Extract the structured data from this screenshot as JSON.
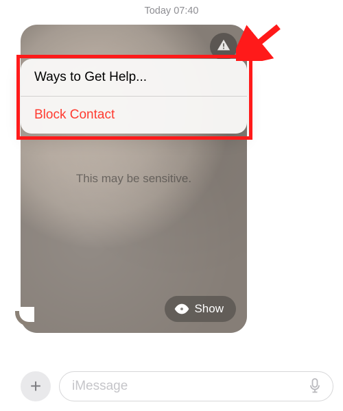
{
  "timestamp": "Today 07:40",
  "bubble": {
    "sensitive_text": "This may be sensitive.",
    "show_label": "Show"
  },
  "popover": {
    "help_label": "Ways to Get Help...",
    "block_label": "Block Contact"
  },
  "input": {
    "placeholder": "iMessage"
  },
  "icons": {
    "warning": "warning-triangle",
    "eye": "eye",
    "plus": "+",
    "mic": "mic"
  },
  "colors": {
    "destructive": "#ff3b30",
    "annotation_red": "#ff1a1a"
  }
}
